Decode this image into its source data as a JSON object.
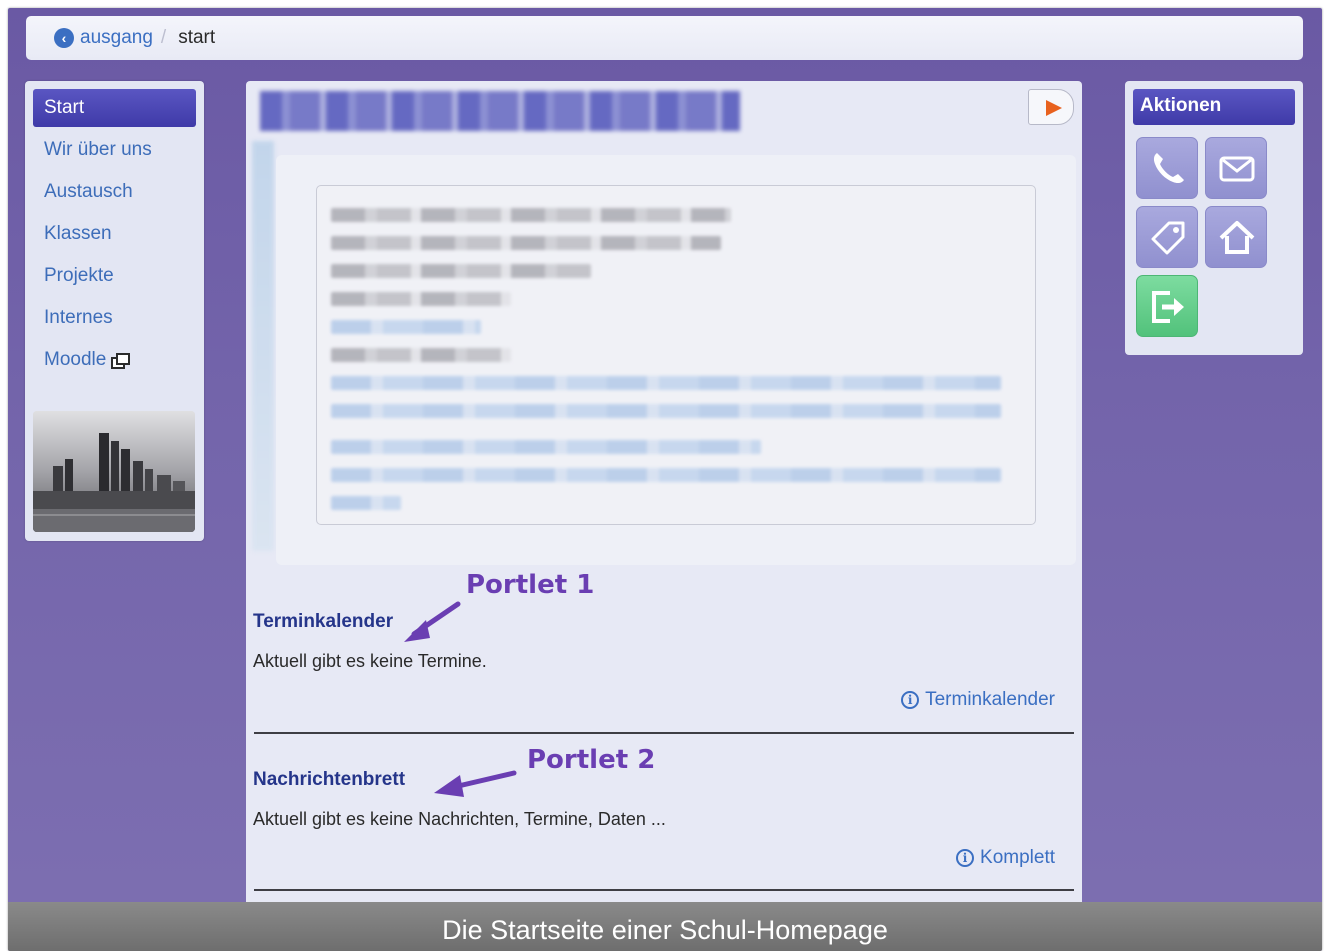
{
  "breadcrumb": {
    "home_icon": "arrow-circle-left-icon",
    "home_label": "ausgang",
    "separator": "/",
    "current": "start"
  },
  "sidebar": {
    "items": [
      {
        "label": "Start",
        "active": true
      },
      {
        "label": "Wir über uns",
        "active": false
      },
      {
        "label": "Austausch",
        "active": false
      },
      {
        "label": "Klassen",
        "active": false
      },
      {
        "label": "Projekte",
        "active": false
      },
      {
        "label": "Internes",
        "active": false
      },
      {
        "label": "Moodle",
        "active": false,
        "icon": "external-window-icon"
      }
    ]
  },
  "portlets": [
    {
      "title": "Terminkalender",
      "body": "Aktuell gibt es keine Termine.",
      "more_label": "Terminkalender",
      "annotation": "Portlet 1"
    },
    {
      "title": "Nachrichtenbrett",
      "body": "Aktuell gibt es keine Nachrichten, Termine, Daten ...",
      "more_label": "Komplett",
      "annotation": "Portlet 2"
    }
  ],
  "actions": {
    "title": "Aktionen",
    "buttons": [
      {
        "icon": "phone-icon"
      },
      {
        "icon": "mail-icon"
      },
      {
        "icon": "tag-icon"
      },
      {
        "icon": "home-icon"
      },
      {
        "icon": "logout-icon"
      }
    ]
  },
  "caption": "Die Startseite einer Schul-Homepage",
  "colors": {
    "background": "#6a59a4",
    "accent": "#3f3aa8",
    "link": "#3b6fc2",
    "annotation": "#6a3eb2",
    "logout": "#52c27b"
  }
}
